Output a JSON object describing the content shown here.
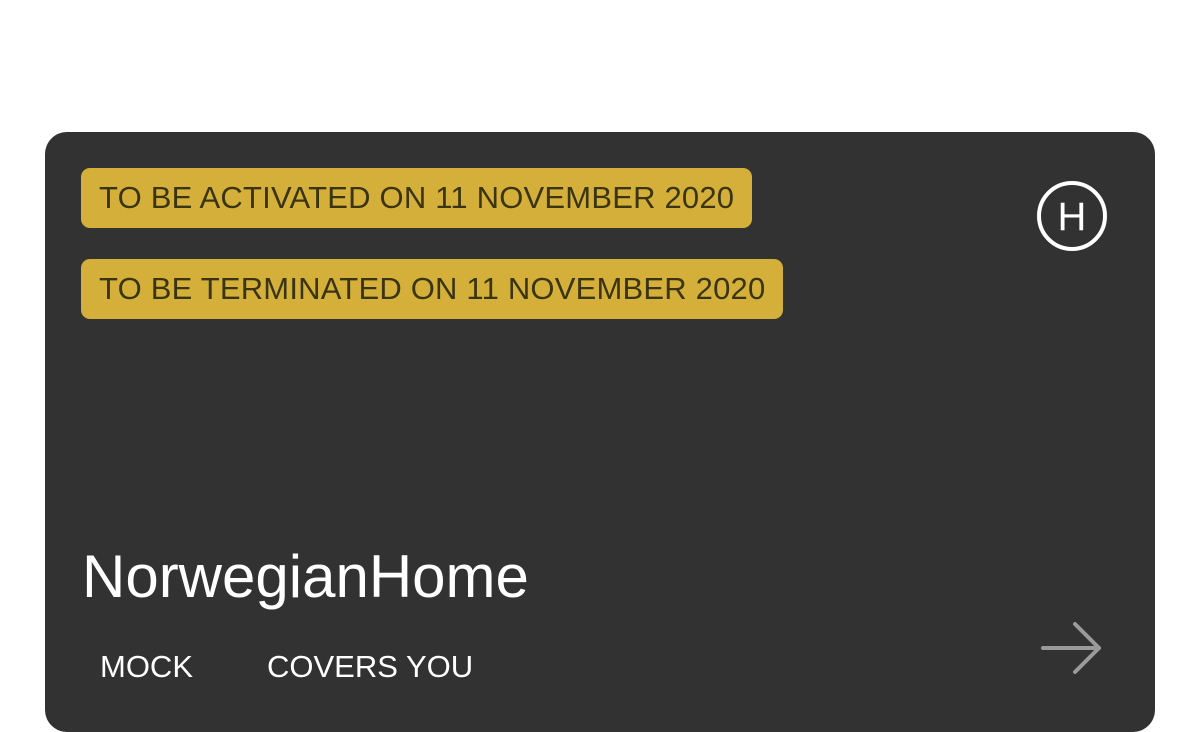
{
  "card": {
    "badges": {
      "activated": "TO BE ACTIVATED ON 11 NOVEMBER 2020",
      "terminated": "TO BE TERMINATED ON 11 NOVEMBER 2020"
    },
    "logo_letter": "H",
    "logo_icon": "h-circle-icon",
    "title": "NorwegianHome",
    "tags": {
      "mock": "MOCK",
      "covers": "COVERS YOU"
    },
    "arrow_icon": "arrow-right-icon"
  },
  "colors": {
    "card_background": "#323232",
    "badge_background": "#d4b03a",
    "badge_text": "#3a3410",
    "text_primary": "#ffffff",
    "arrow": "#9a9a9a"
  }
}
